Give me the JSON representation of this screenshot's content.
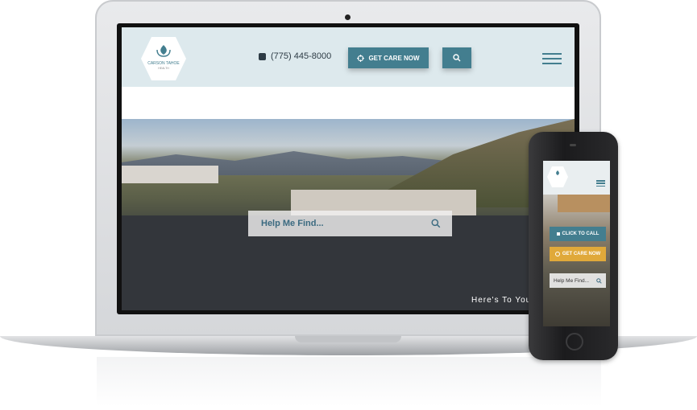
{
  "site": {
    "brand": "CARSON TAHOE",
    "brand_sub": "HEALTH",
    "phone": "(775) 445-8000",
    "cta_label": "GET CARE NOW",
    "search_placeholder": "Help Me Find...",
    "tagline": "Here's To You"
  },
  "mobile": {
    "call_label": "CLICK TO CALL",
    "care_label": "GET CARE NOW",
    "search_placeholder": "Help Me Find..."
  },
  "colors": {
    "teal": "#437e8f",
    "header_bg": "#dde9ed",
    "gold": "#e0a93a"
  },
  "icons": [
    "phone-icon",
    "location-icon",
    "search-icon",
    "menu-icon"
  ]
}
